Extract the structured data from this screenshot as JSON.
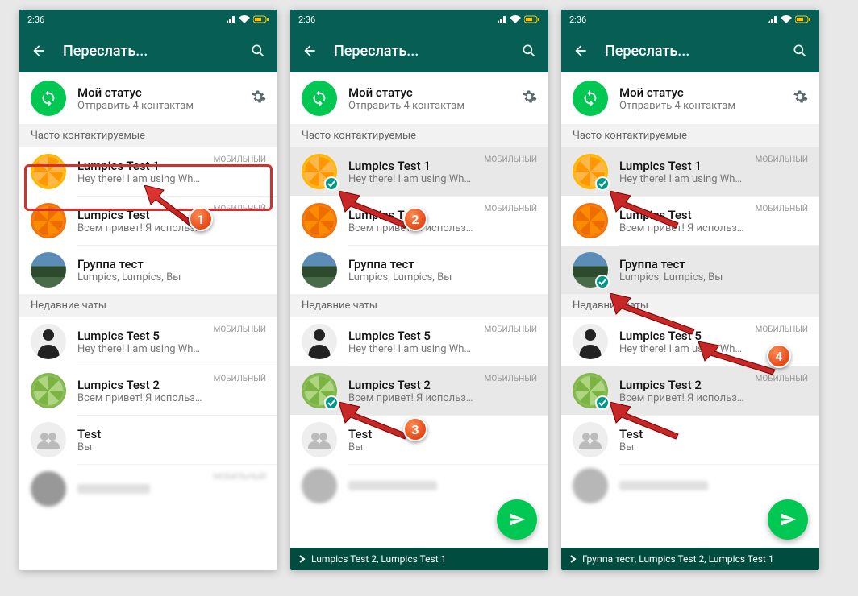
{
  "statusbar": {
    "time": "2:36"
  },
  "appbar": {
    "title": "Переслать..."
  },
  "status": {
    "title": "Мой статус",
    "subtitle": "Отправить 4 контактам"
  },
  "sections": {
    "frequent": "Часто контактируемые",
    "recent": "Недавние чаты"
  },
  "contacts": {
    "c1": {
      "name": "Lumpics Test 1",
      "sub": "Hey there! I am using WhatsApp.",
      "tag": "МОБИЛЬНЫЙ"
    },
    "c2": {
      "name": "Lumpics Test",
      "sub": "Всем привет! Я использую WhatsApp.",
      "tag": "МОБИЛЬНЫЙ"
    },
    "c3": {
      "name": "Группа тест",
      "sub": "Lumpics, Lumpics, Вы"
    },
    "c4": {
      "name": "Lumpics Test 5",
      "sub": "Hey there! I am using WhatsApp.",
      "tag": "МОБИЛЬНЫЙ"
    },
    "c5": {
      "name": "Lumpics Test 2",
      "sub": "Всем привет! Я использую WhatsApp.",
      "tag": "МОБИЛЬНЫЙ"
    },
    "c6": {
      "name": "Test",
      "sub": "Вы"
    },
    "ghost_tag": "МОБИЛЬНЫЙ"
  },
  "bottombar": {
    "phone2": "Lumpics Test 2, Lumpics Test 1",
    "phone3": "Группа тест, Lumpics Test 2, Lumpics Test 1"
  },
  "badges": {
    "b1": "1",
    "b2": "2",
    "b3": "3",
    "b4": "4"
  }
}
